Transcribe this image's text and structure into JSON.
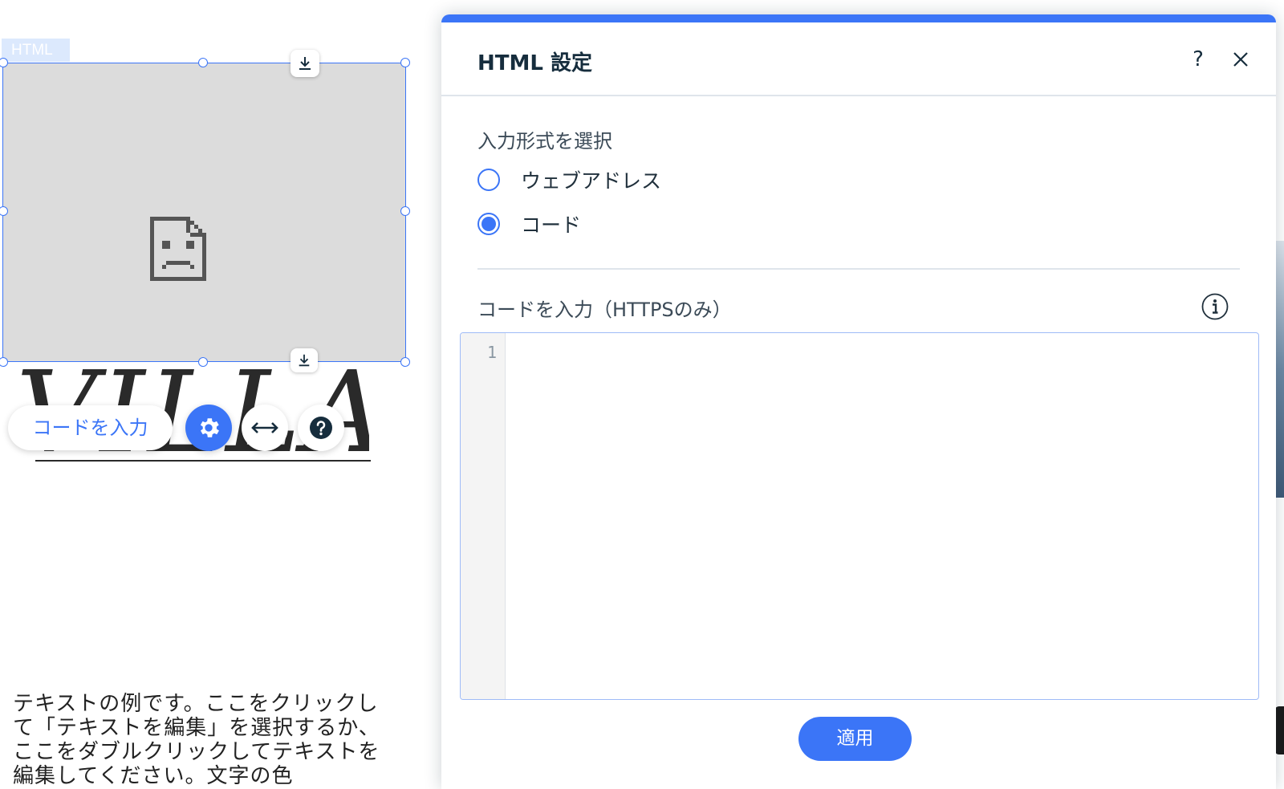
{
  "canvas": {
    "html_tag_label": "HTML",
    "villa_text": "VILLA",
    "toolbar": {
      "enter_code_label": "コードを入力"
    },
    "sample_text": "テキストの例です。ここをクリックして「テキストを編集」を選択するか、ここをダブルクリックしてテキストを編集してください。文字の色"
  },
  "panel": {
    "title": "HTML 設定",
    "help_label": "?",
    "input_type_label": "入力形式を選択",
    "options": [
      {
        "label": "ウェブアドレス",
        "selected": false
      },
      {
        "label": "コード",
        "selected": true
      }
    ],
    "code_label": "コードを入力（HTTPSのみ）",
    "editor": {
      "line_numbers": [
        "1"
      ],
      "content": ""
    },
    "apply_label": "適用"
  },
  "colors": {
    "accent": "#3b75f7",
    "placeholder_bg": "#dcdcdc",
    "title": "#162d3d"
  },
  "icons": [
    "broken-image-icon",
    "download-anchor-icon",
    "gear-icon",
    "stretch-arrows-icon",
    "help-icon",
    "close-icon",
    "info-icon"
  ]
}
